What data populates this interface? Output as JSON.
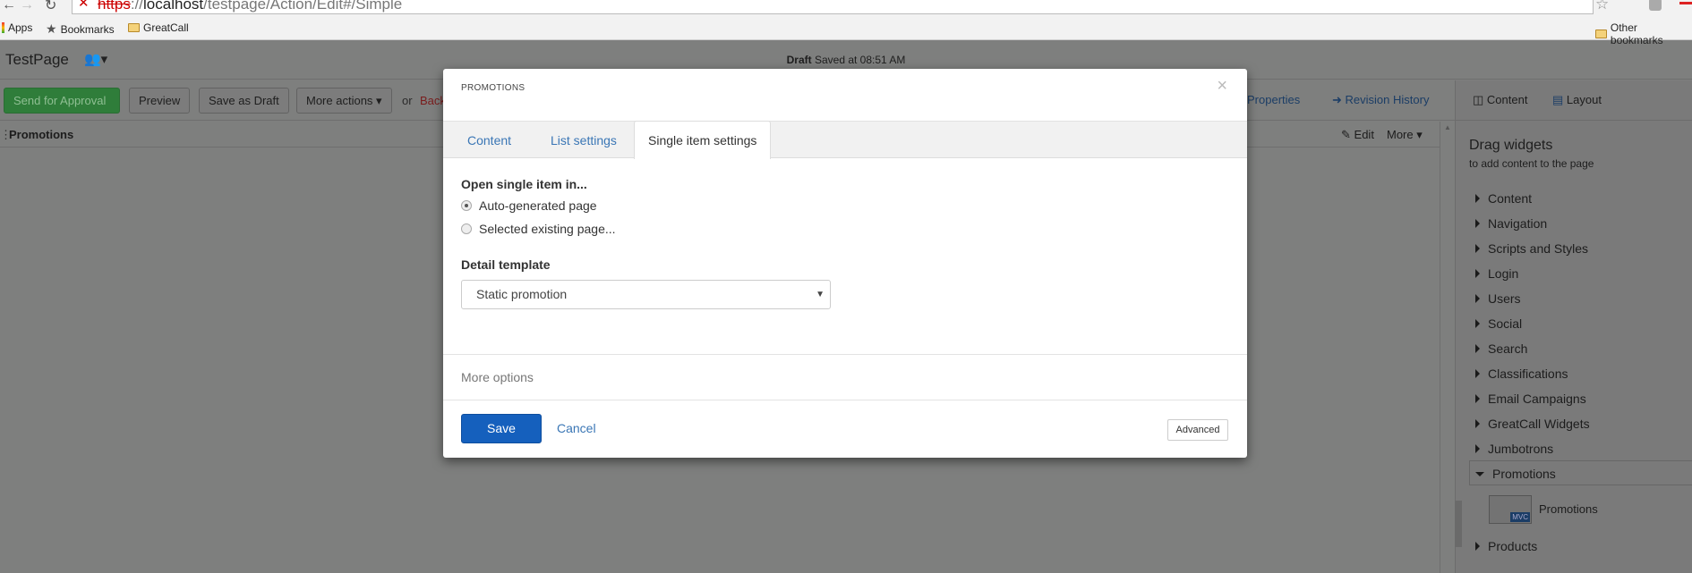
{
  "browser": {
    "url_scheme": "https",
    "url_host": "localhost",
    "url_path": "/testpage/Action/Edit#/Simple",
    "bookmarks": [
      "Apps",
      "Bookmarks",
      "GreatCall"
    ],
    "other_bookmarks": "Other bookmarks"
  },
  "header": {
    "title": "TestPage",
    "status": "Draft",
    "saved": "Saved at 08:51 AM"
  },
  "toolbar": {
    "send": "Send for Approval",
    "preview": "Preview",
    "save_draft": "Save as Draft",
    "more_actions": "More actions",
    "or": "or",
    "back": "Back",
    "properties": "Properties",
    "revision_history": "Revision History"
  },
  "sidebar_tabs": {
    "content": "Content",
    "layout": "Layout"
  },
  "placeholder_bar": {
    "title": "Promotions",
    "edit": "Edit",
    "more": "More"
  },
  "sidebar": {
    "heading": "Drag widgets",
    "subheading": "to add content to the page",
    "groups": [
      "Content",
      "Navigation",
      "Scripts and Styles",
      "Login",
      "Users",
      "Social",
      "Search",
      "Classifications",
      "Email Campaigns",
      "GreatCall Widgets",
      "Jumbotrons",
      "Promotions"
    ],
    "expanded_widget": "Promotions",
    "widget_badge": "MVC",
    "last_group": "Products"
  },
  "modal": {
    "title": "PROMOTIONS",
    "close": "×",
    "tabs": [
      {
        "label": "Content"
      },
      {
        "label": "List settings"
      },
      {
        "label": "Single item settings",
        "active": true
      }
    ],
    "open_in_label": "Open single item in...",
    "options": [
      {
        "label": "Auto-generated page",
        "checked": true
      },
      {
        "label": "Selected existing page...",
        "checked": false
      }
    ],
    "detail_template_label": "Detail template",
    "detail_template_value": "Static promotion",
    "more_options": "More options",
    "save": "Save",
    "cancel": "Cancel",
    "advanced": "Advanced"
  },
  "colors": {
    "primary": "#1560bd",
    "link": "#3a76b5",
    "approve": "#2f7d3a"
  }
}
